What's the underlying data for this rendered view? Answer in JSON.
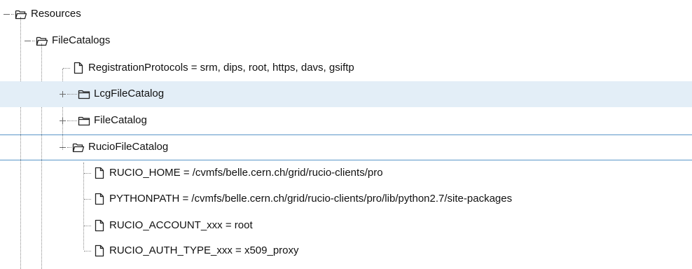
{
  "tree": {
    "nodes": [
      {
        "label": "Resources",
        "kind": "folder",
        "state": "expanded",
        "level": 0
      },
      {
        "label": "FileCatalogs",
        "kind": "folder",
        "state": "expanded",
        "level": 1
      },
      {
        "label": "RegistrationProtocols = srm, dips, root, https, davs, gsiftp",
        "kind": "option",
        "state": "leaf",
        "level": 2
      },
      {
        "label": "LcgFileCatalog",
        "kind": "folder",
        "state": "collapsed",
        "level": 2,
        "selected": true
      },
      {
        "label": "FileCatalog",
        "kind": "folder",
        "state": "collapsed",
        "level": 2
      },
      {
        "label": "RucioFileCatalog",
        "kind": "folder",
        "state": "expanded",
        "level": 2,
        "focused": true
      },
      {
        "label": "RUCIO_HOME = /cvmfs/belle.cern.ch/grid/rucio-clients/pro",
        "kind": "option",
        "state": "leaf",
        "level": 3
      },
      {
        "label": "PYTHONPATH = /cvmfs/belle.cern.ch/grid/rucio-clients/pro/lib/python2.7/site-packages",
        "kind": "option",
        "state": "leaf",
        "level": 3
      },
      {
        "label": "RUCIO_ACCOUNT_xxx = root",
        "kind": "option",
        "state": "leaf",
        "level": 3
      },
      {
        "label": "RUCIO_AUTH_TYPE_xxx = x509_proxy",
        "kind": "option",
        "state": "leaf",
        "level": 3
      }
    ]
  },
  "colors": {
    "selected_row": "#e3eef7",
    "focus_border": "#5b96c8",
    "guide_line": "#8a8a8a",
    "text": "#111111"
  },
  "icons": {
    "folder_expanded": "folder-open-icon",
    "folder_collapsed": "folder-icon",
    "option": "file-icon"
  }
}
